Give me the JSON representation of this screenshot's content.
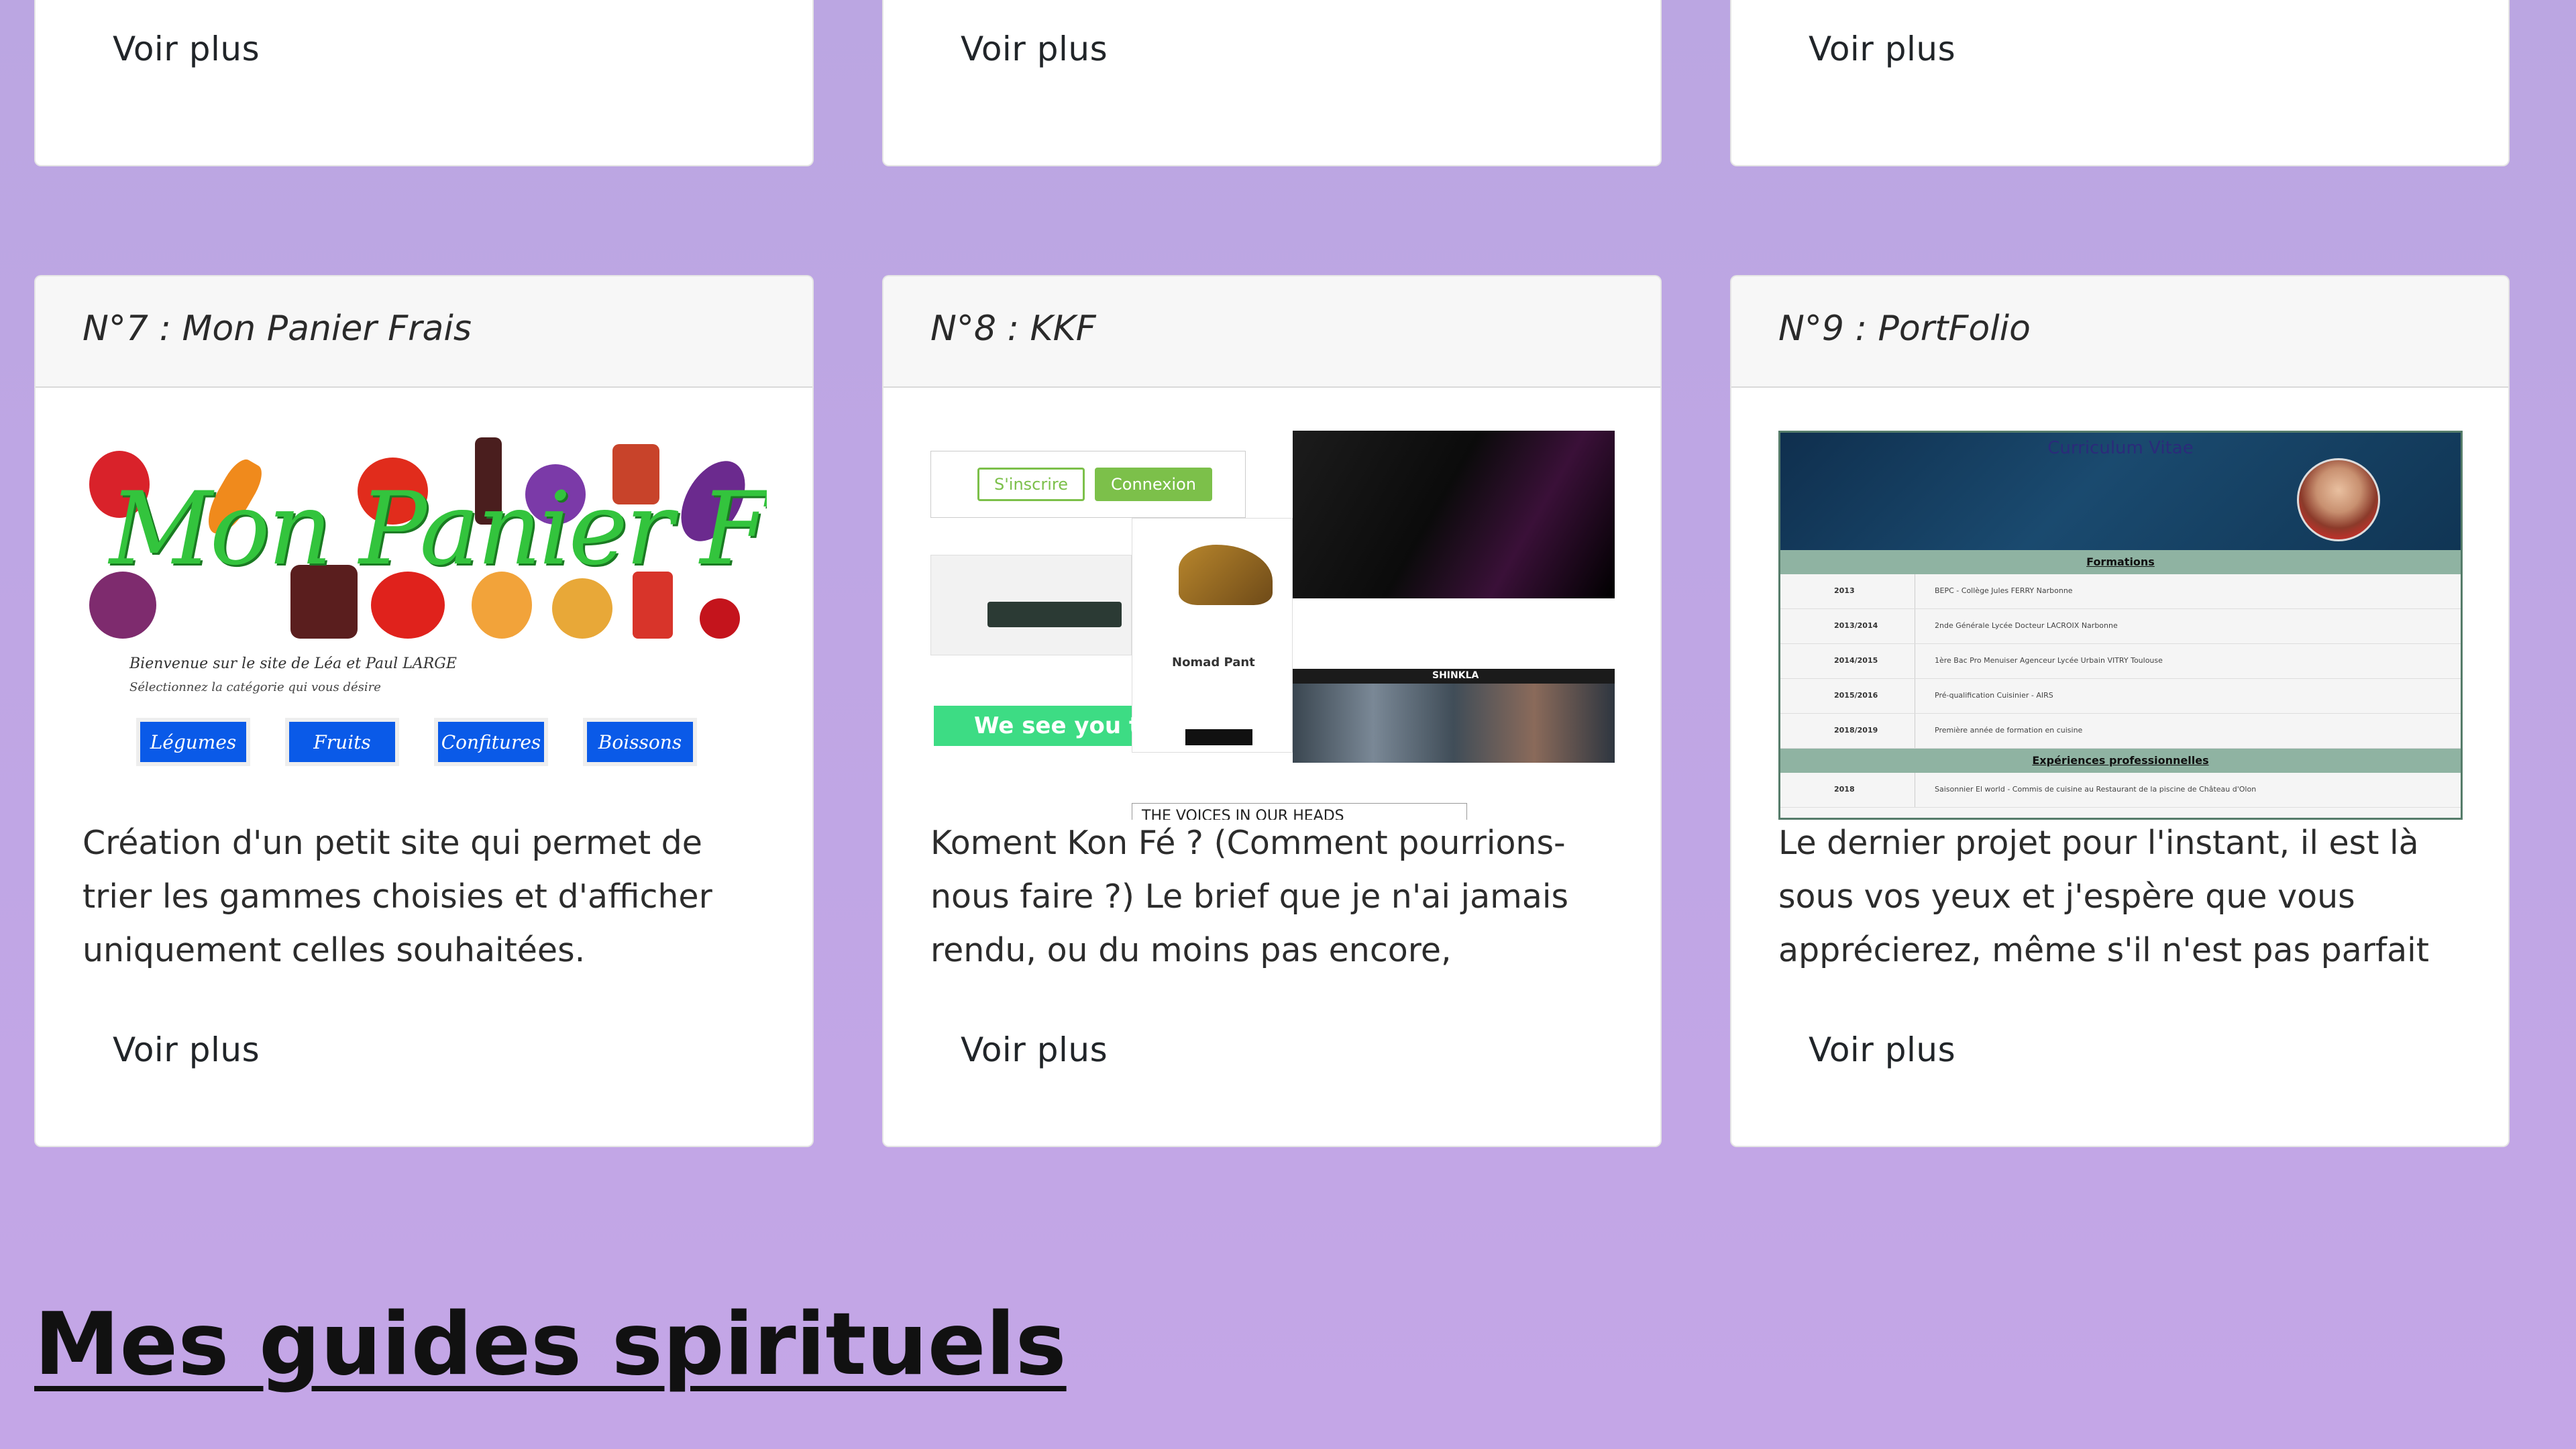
{
  "top_cards": [
    {
      "link": "Voir plus"
    },
    {
      "link": "Voir plus"
    },
    {
      "link": "Voir plus"
    }
  ],
  "projects": [
    {
      "title": "N°7 : Mon Panier Frais",
      "description": "Création d'un petit site qui permet de trier les gammes choisies et d'afficher uniquement celles souhaitées.",
      "link": "Voir plus",
      "image": {
        "logo": "Mon Panier Frais",
        "welcome": "Bienvenue sur le site de Léa et Paul LARGE",
        "choose": "Sélectionnez la catégorie qui vous désire",
        "buttons": [
          "Légumes",
          "Fruits",
          "Confitures",
          "Boissons"
        ]
      }
    },
    {
      "title": "N°8 : KKF",
      "description": "Koment Kon Fé ? (Comment pourrions-nous faire ?) Le brief que je n'ai jamais rendu, ou du moins pas encore,",
      "link": "Voir plus",
      "image": {
        "signup": "S'inscrire",
        "login": "Connexion",
        "banner": "We see you t",
        "brand": "Nomad Pant",
        "footer": "THE VOICES IN OUR HEADS",
        "nav": "SHINKLA"
      }
    },
    {
      "title": "N°9 : PortFolio",
      "description": "Le dernier projet pour l'instant, il est là sous vos yeux et j'espère que vous apprécierez, même s'il n'est pas parfait",
      "link": "Voir plus",
      "image": {
        "title": "Curriculum Vitae",
        "formations": "Formations",
        "rows": [
          {
            "year": "2013",
            "desc": "BEPC - Collège Jules FERRY Narbonne"
          },
          {
            "year": "2013/2014",
            "desc": "2nde Générale Lycée Docteur LACROIX Narbonne"
          },
          {
            "year": "2014/2015",
            "desc": "1ère Bac Pro Menuiser Agenceur Lycée Urbain VITRY Toulouse"
          },
          {
            "year": "2015/2016",
            "desc": "Pré-qualification Cuisinier - AIRS"
          },
          {
            "year": "2018/2019",
            "desc": "Première année de formation en cuisine"
          }
        ],
        "experiences": "Expériences professionnelles",
        "exp_row": {
          "year": "2018",
          "desc": "Saisonnier El world - Commis de cuisine au Restaurant de la piscine de Château d'Olon"
        }
      }
    }
  ],
  "section_title": "Mes guides spirituels",
  "colors": {
    "background": "#c2a7e6",
    "green": "#33c43d",
    "blue": "#0a5ae8"
  }
}
